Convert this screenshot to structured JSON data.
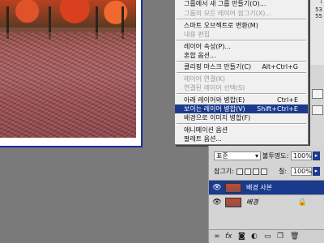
{
  "info_strip": [
    "ᅡ",
    "53",
    "55"
  ],
  "context_menu": {
    "items": [
      {
        "label": "그룹에서 새 그룹 만들기(O)...",
        "enabled": true,
        "shortcut": ""
      },
      {
        "label": "그룹의 모든 레이어 잠그기(X)...",
        "enabled": false,
        "shortcut": ""
      },
      {
        "label": "스마트 오브젝트로 변환(M)",
        "enabled": true,
        "shortcut": ""
      },
      {
        "label": "내용 편집",
        "enabled": false,
        "shortcut": ""
      },
      {
        "label": "레이어 속성(P)...",
        "enabled": true,
        "shortcut": ""
      },
      {
        "label": "혼합 옵션...",
        "enabled": true,
        "shortcut": ""
      },
      {
        "label": "클리핑 마스크 만들기(C)",
        "enabled": true,
        "shortcut": "Alt+Ctrl+G"
      },
      {
        "label": "레이어 연결(K)",
        "enabled": false,
        "shortcut": ""
      },
      {
        "label": "연결된 레이어 선택(S)",
        "enabled": false,
        "shortcut": ""
      },
      {
        "label": "아래 레이어와 병합(E)",
        "enabled": true,
        "shortcut": "Ctrl+E"
      },
      {
        "label": "보이는 레이어 병합(V)",
        "enabled": true,
        "shortcut": "Shift+Ctrl+E",
        "highlighted": true
      },
      {
        "label": "배경으로 이미지 병합(F)",
        "enabled": true,
        "shortcut": ""
      },
      {
        "label": "애니메이션 옵션",
        "enabled": true,
        "shortcut": ""
      },
      {
        "label": "팔레트 옵션...",
        "enabled": true,
        "shortcut": ""
      }
    ]
  },
  "layers_panel": {
    "blend_mode": "표준",
    "opacity_label": "불투명도:",
    "opacity_value": "100%",
    "lock_label": "잠그기:",
    "fill_label": "칠:",
    "fill_value": "100%",
    "layers": [
      {
        "name": "배경 사본",
        "selected": true,
        "locked": false
      },
      {
        "name": "배경",
        "selected": false,
        "locked": true
      }
    ],
    "footer_icons": [
      "link-icon",
      "fx-icon",
      "mask-icon",
      "adjustment-icon",
      "folder-icon",
      "new-layer-icon",
      "trash-icon"
    ]
  },
  "colors": {
    "highlight": "#1b3a8e",
    "menu_bg": "#f0f0f0",
    "workspace": "#7a7a7a"
  }
}
